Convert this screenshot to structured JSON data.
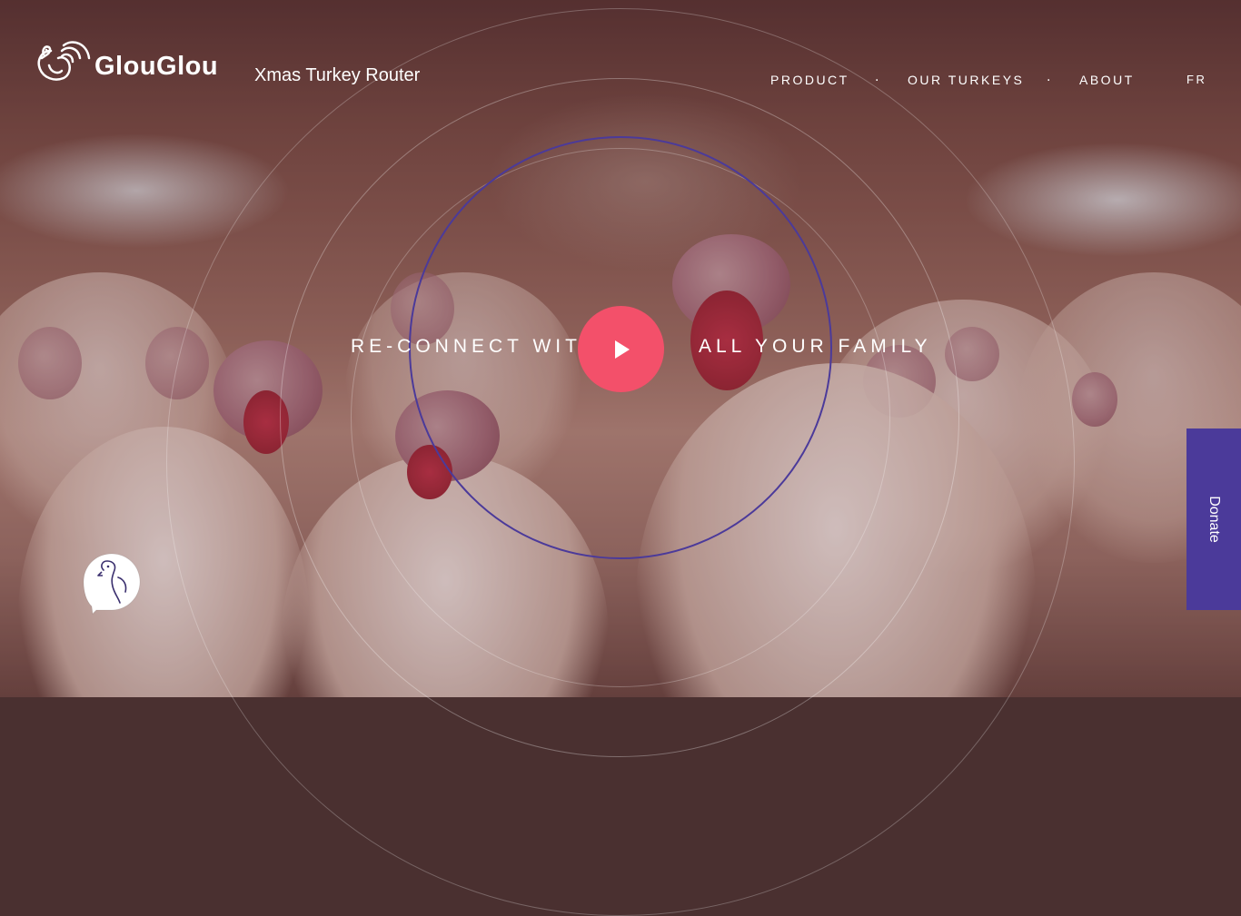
{
  "brand": {
    "name": "GlouGlou",
    "tagline": "Xmas Turkey Router"
  },
  "nav": {
    "items": [
      "PRODUCT",
      "OUR TURKEYS",
      "ABOUT"
    ],
    "separator": ".",
    "language": "FR"
  },
  "hero": {
    "left_text": "RE-CONNECT WITH",
    "right_text": "ALL YOUR FAMILY",
    "play_icon": "play-icon"
  },
  "donate": {
    "label": "Donate"
  },
  "chat_widget": {
    "icon": "turkey-chat-icon"
  },
  "colors": {
    "accent_play": "#f3506a",
    "donate_bg": "#4b3a9a",
    "ring_accent": "#4b3a9a"
  }
}
